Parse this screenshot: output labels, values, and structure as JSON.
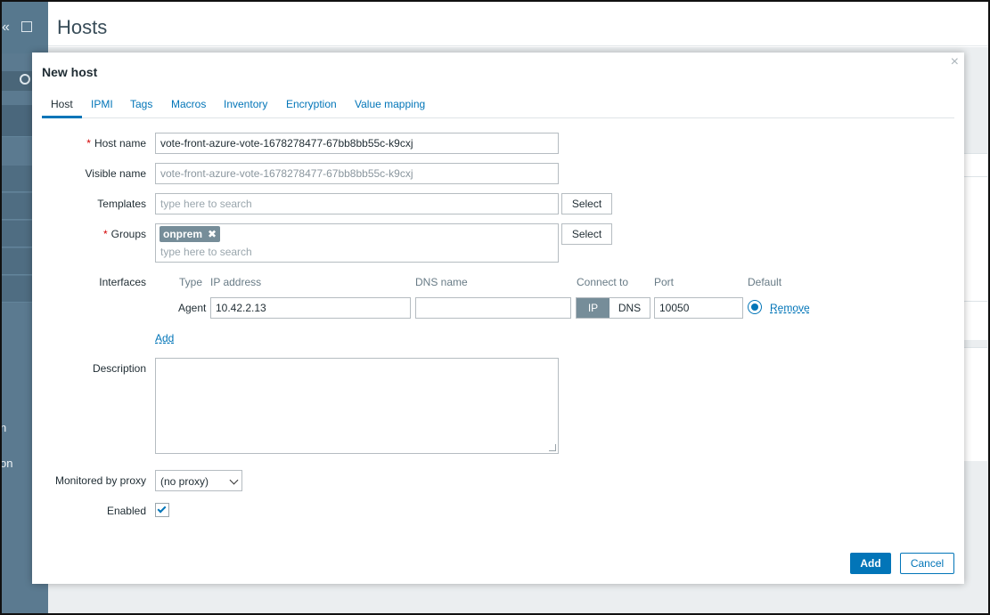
{
  "page": {
    "title": "Hosts"
  },
  "sidebar": {
    "text_1": "n",
    "text_2": "on"
  },
  "dialog": {
    "title": "New host",
    "close_icon": "close-icon",
    "tabs": [
      {
        "label": "Host",
        "active": true
      },
      {
        "label": "IPMI"
      },
      {
        "label": "Tags"
      },
      {
        "label": "Macros"
      },
      {
        "label": "Inventory"
      },
      {
        "label": "Encryption"
      },
      {
        "label": "Value mapping"
      }
    ],
    "form": {
      "host_name": {
        "label": "Host name",
        "value": "vote-front-azure-vote-1678278477-67bb8bb55c-k9cxj",
        "required": true
      },
      "visible_name": {
        "label": "Visible name",
        "placeholder": "vote-front-azure-vote-1678278477-67bb8bb55c-k9cxj"
      },
      "templates": {
        "label": "Templates",
        "placeholder": "type here to search",
        "select_label": "Select"
      },
      "groups": {
        "label": "Groups",
        "required": true,
        "chips": [
          "onprem"
        ],
        "placeholder": "type here to search",
        "select_label": "Select"
      },
      "interfaces": {
        "label": "Interfaces",
        "columns": {
          "type": "Type",
          "ip": "IP address",
          "dns": "DNS name",
          "connect": "Connect to",
          "port": "Port",
          "default": "Default"
        },
        "rows": [
          {
            "type": "Agent",
            "ip": "10.42.2.13",
            "dns": "",
            "connect_ip": "IP",
            "connect_dns": "DNS",
            "connect_selected": "IP",
            "port": "10050",
            "default": true,
            "remove_label": "Remove"
          }
        ],
        "add_label": "Add"
      },
      "description": {
        "label": "Description",
        "value": ""
      },
      "proxy": {
        "label": "Monitored by proxy",
        "value": "(no proxy)"
      },
      "enabled": {
        "label": "Enabled",
        "checked": true
      }
    },
    "buttons": {
      "add": "Add",
      "cancel": "Cancel"
    },
    "colors": {
      "accent": "#0275b8",
      "chip": "#768d99",
      "required": "#d40000"
    }
  }
}
